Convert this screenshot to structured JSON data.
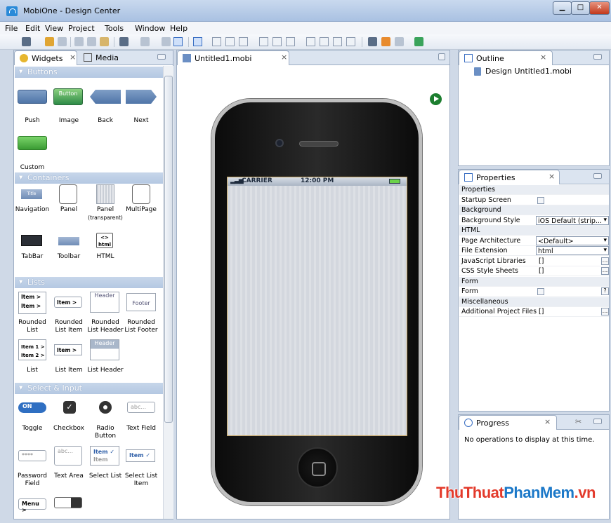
{
  "window": {
    "title": "MobiOne - Design Center"
  },
  "menu": [
    "File",
    "Edit",
    "View",
    "Project",
    "Tools",
    "Window",
    "Help"
  ],
  "palette": {
    "tabs": [
      {
        "label": "Widgets"
      },
      {
        "label": "Media"
      }
    ],
    "sections": [
      {
        "title": "Buttons",
        "items": [
          "Push",
          "Image",
          "Back",
          "Next",
          "Custom"
        ],
        "image_button_text": "Button"
      },
      {
        "title": "Containers",
        "items": [
          "Navigation",
          "Panel",
          "Panel",
          "MultiPage",
          "TabBar",
          "Toolbar",
          "HTML"
        ],
        "panel_sub": "(transparent)",
        "nav_text": "Title",
        "html_text": "html"
      },
      {
        "title": "Lists",
        "items": [
          "Rounded List",
          "Rounded List Item",
          "Rounded List Header",
          "Rounded List Footer",
          "List",
          "List Item",
          "List Header"
        ],
        "samples": {
          "item": "Item",
          "item1": "Item 1",
          "item2": "Item 2",
          "header": "Header",
          "footer": "Footer"
        }
      },
      {
        "title": "Select & Input",
        "items": [
          "Toggle",
          "Checkbox",
          "Radio Button",
          "Text Field",
          "Password Field",
          "Text Area",
          "Select List",
          "Select List Item"
        ],
        "samples": {
          "on": "ON",
          "abc": "abc...",
          "item": "Item",
          "menu": "Menu",
          "pwd": "****"
        }
      }
    ]
  },
  "editor": {
    "tab": "Untitled1.mobi",
    "status_bar": {
      "carrier": "CARRIER",
      "time": "12:00 PM"
    }
  },
  "outline": {
    "tab": "Outline",
    "item": "Design Untitled1.mobi"
  },
  "properties": {
    "tab": "Properties",
    "rows": [
      {
        "label": "Properties",
        "cat": true
      },
      {
        "label": "Startup Screen",
        "type": "check"
      },
      {
        "label": "Background",
        "cat": true
      },
      {
        "label": "Background Style",
        "type": "select",
        "value": "iOS Default (strip..."
      },
      {
        "label": "HTML",
        "cat": true
      },
      {
        "label": "Page Architecture",
        "type": "select",
        "value": "<Default>"
      },
      {
        "label": "File Extension",
        "type": "select",
        "value": "html"
      },
      {
        "label": "JavaScript Libraries",
        "type": "list",
        "value": "[]"
      },
      {
        "label": "CSS Style Sheets",
        "type": "list",
        "value": "[]"
      },
      {
        "label": "Form",
        "cat": true
      },
      {
        "label": "Form",
        "type": "check-help"
      },
      {
        "label": "Miscellaneous",
        "cat": true
      },
      {
        "label": "Additional Project Files",
        "type": "list",
        "value": "[]"
      }
    ]
  },
  "progress": {
    "tab": "Progress",
    "message": "No operations to display at this time."
  },
  "watermark": {
    "part1": "ThuThuat",
    "part2": "PhanMem",
    "part3": ".vn"
  },
  "colors": {
    "accent": "#2f6fc2",
    "section_header": "#b4c8e2"
  }
}
